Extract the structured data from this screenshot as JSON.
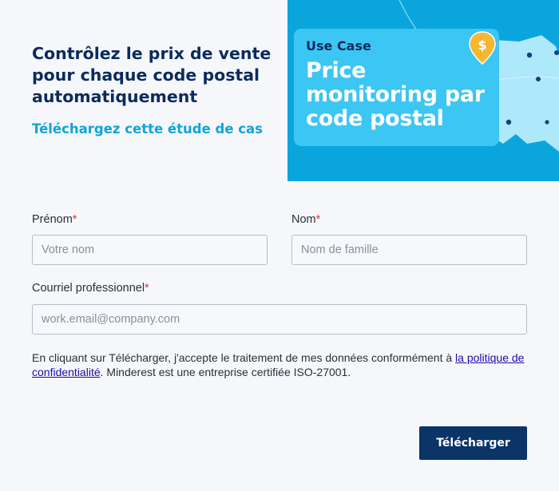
{
  "header": {
    "headline": "Contrôlez le prix de vente pour chaque code postal automatiquement",
    "subheadline": "Téléchargez cette étude de cas"
  },
  "banner": {
    "eyebrow": "Use Case",
    "title_lines": [
      "Price",
      "monitoring par",
      "code postal"
    ],
    "pin_symbol": "$",
    "colors": {
      "background": "#0ba5de",
      "card": "#3cc6f3",
      "pin": "#f7b731"
    }
  },
  "form": {
    "first_name": {
      "label": "Prénom",
      "required_mark": "*",
      "placeholder": "Votre nom",
      "value": ""
    },
    "last_name": {
      "label": "Nom",
      "required_mark": "*",
      "placeholder": "Nom de famille",
      "value": ""
    },
    "email": {
      "label": "Courriel professionnel",
      "required_mark": "*",
      "placeholder": "work.email@company.com",
      "value": ""
    },
    "consent": {
      "text_before": "En cliquant sur Télécharger, j'accepte le traitement de mes données conformément à ",
      "link_text": "la politique de confidentialité",
      "text_after": ". Minderest est une entreprise certifiée ISO-27001."
    },
    "submit_label": "Télécharger"
  },
  "colors": {
    "accent": "#0ea5dd",
    "navy": "#0b2b5e",
    "button": "#0b3467",
    "required": "#d9363e"
  }
}
